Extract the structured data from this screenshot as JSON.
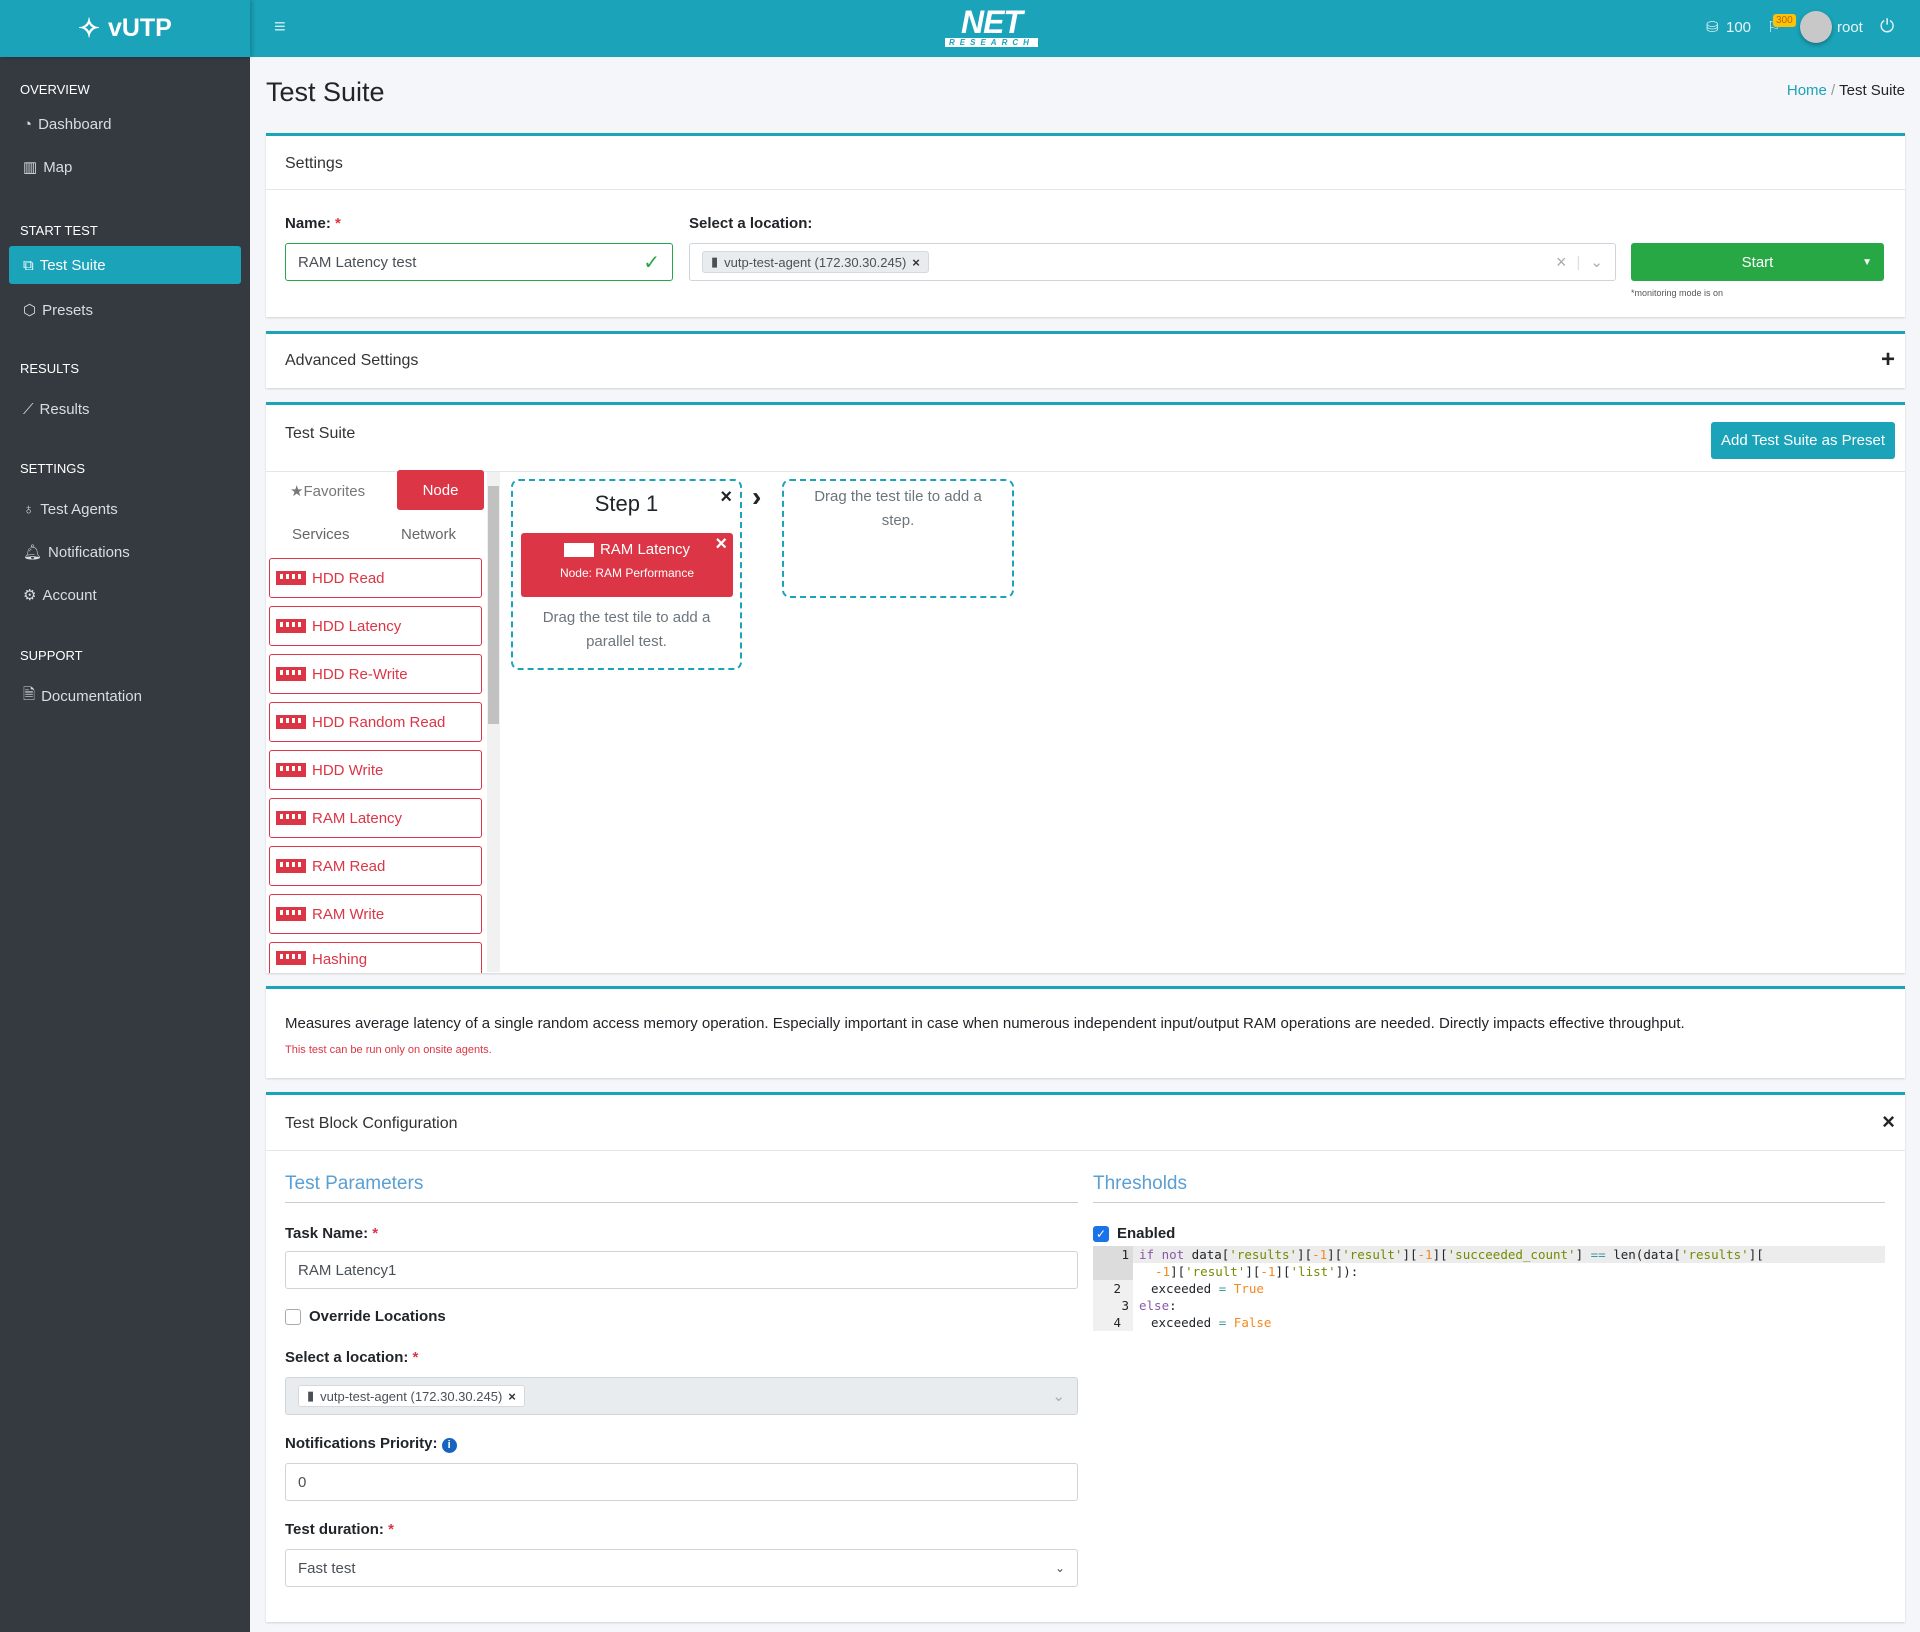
{
  "header": {
    "brand": "vUTP",
    "logo_text": "NET",
    "logo_sub": "RESEARCH",
    "credits": "100",
    "notifications_badge": "300",
    "user": "root",
    "accent": "#1aa3b9"
  },
  "sidebar": {
    "sections": [
      {
        "title": "OVERVIEW",
        "items": [
          {
            "label": "Dashboard",
            "icon": "dashboard-icon"
          },
          {
            "label": "Map",
            "icon": "map-icon"
          }
        ]
      },
      {
        "title": "START TEST",
        "items": [
          {
            "label": "Test Suite",
            "icon": "sitemap-icon",
            "active": true
          },
          {
            "label": "Presets",
            "icon": "cube-icon"
          }
        ]
      },
      {
        "title": "RESULTS",
        "items": [
          {
            "label": "Results",
            "icon": "chart-icon"
          }
        ]
      },
      {
        "title": "SETTINGS",
        "items": [
          {
            "label": "Test Agents",
            "icon": "stethoscope-icon"
          },
          {
            "label": "Notifications",
            "icon": "bell-icon"
          },
          {
            "label": "Account",
            "icon": "gear-icon"
          }
        ]
      },
      {
        "title": "SUPPORT",
        "items": [
          {
            "label": "Documentation",
            "icon": "file-icon"
          }
        ]
      }
    ]
  },
  "page": {
    "title": "Test Suite",
    "breadcrumb": [
      "Home",
      "Test Suite"
    ]
  },
  "settings": {
    "title": "Settings",
    "name_label": "Name:",
    "name_value": "RAM Latency test",
    "location_label": "Select a location:",
    "location_chip": "vutp-test-agent (172.30.30.245)",
    "start_label": "Start",
    "monitoring_note": "*monitoring mode is on"
  },
  "advanced": {
    "title": "Advanced Settings"
  },
  "suite": {
    "title": "Test Suite",
    "preset_button": "Add Test Suite as Preset",
    "tabs": [
      "Favorites",
      "Node",
      "Services",
      "Network"
    ],
    "tiles": [
      "HDD Read",
      "HDD Latency",
      "HDD Re-Write",
      "HDD Random Read",
      "HDD Write",
      "RAM Latency",
      "RAM Read",
      "RAM Write",
      "Hashing"
    ],
    "step": {
      "title": "Step 1",
      "test_name": "RAM Latency",
      "test_sub": "Node: RAM Performance",
      "parallel_hint": "Drag the test tile to add a parallel test."
    },
    "next_step_hint": "Drag the test tile to add a step."
  },
  "description": {
    "text": "Measures average latency of a single random access memory operation. Especially important in case when numerous independent input/output RAM operations are needed. Directly impacts effective throughput.",
    "note": "This test can be run only on onsite agents."
  },
  "config": {
    "title": "Test Block Configuration",
    "params_title": "Test Parameters",
    "thresholds_title": "Thresholds",
    "task_name_label": "Task Name:",
    "task_name_value": "RAM Latency1",
    "override_label": "Override Locations",
    "location_label": "Select a location:",
    "location_chip": "vutp-test-agent (172.30.30.245)",
    "priority_label": "Notifications Priority:",
    "priority_value": "0",
    "duration_label": "Test duration:",
    "duration_value": "Fast test",
    "enabled_label": "Enabled",
    "code_lines": [
      "1",
      "",
      "2",
      "3",
      "4"
    ]
  }
}
